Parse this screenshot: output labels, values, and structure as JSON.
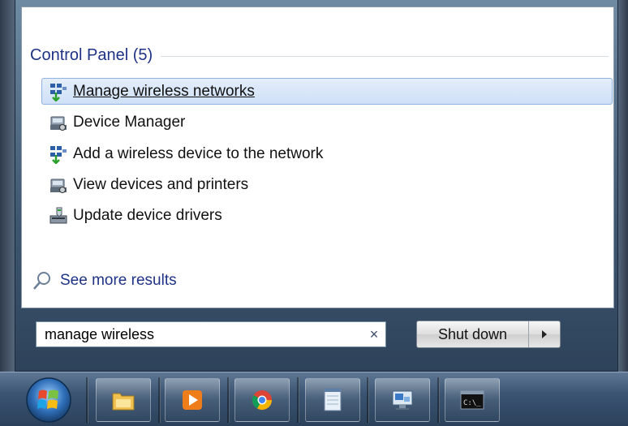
{
  "start_menu": {
    "section": {
      "title": "Control Panel (5)"
    },
    "results": [
      {
        "label": "Manage wireless networks",
        "icon": "wireless-network-icon"
      },
      {
        "label": "Device Manager",
        "icon": "device-manager-icon"
      },
      {
        "label": "Add a wireless device to the network",
        "icon": "wireless-network-icon"
      },
      {
        "label": "View devices and printers",
        "icon": "printer-icon"
      },
      {
        "label": "Update device drivers",
        "icon": "device-driver-icon"
      }
    ],
    "see_more": "See more results",
    "search": {
      "value": "manage wireless",
      "clear_symbol": "×"
    },
    "shutdown": {
      "label": "Shut down"
    }
  },
  "taskbar": {
    "items": [
      {
        "name": "file-explorer",
        "icon": "folder-icon"
      },
      {
        "name": "media-player",
        "icon": "media-player-icon"
      },
      {
        "name": "chrome",
        "icon": "chrome-icon"
      },
      {
        "name": "notepad",
        "icon": "notepad-icon"
      },
      {
        "name": "remote-desktop",
        "icon": "remote-desktop-icon"
      },
      {
        "name": "command-prompt",
        "icon": "command-prompt-icon",
        "text": "C:\\_"
      }
    ]
  },
  "colors": {
    "header_text": "#1e3287",
    "selection": "#cfe0f6",
    "taskbar": "#3a5472"
  }
}
